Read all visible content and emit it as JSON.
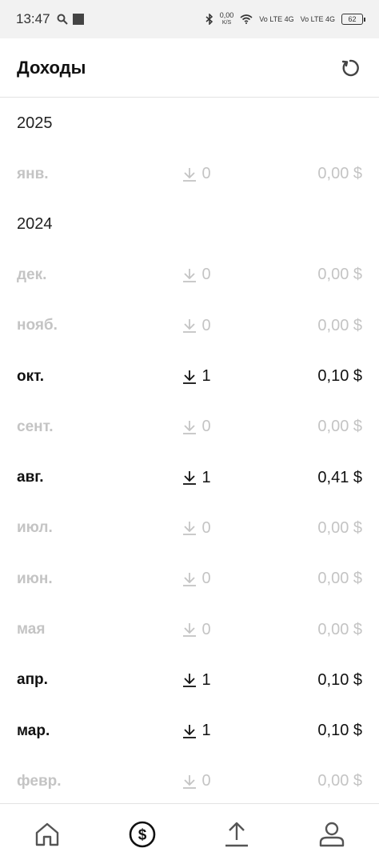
{
  "status_bar": {
    "time": "13:47",
    "net_speed": "0,00",
    "net_unit": "K/S",
    "signal1": "Vo LTE 4G",
    "signal2": "Vo LTE 4G",
    "battery": "62"
  },
  "header": {
    "title": "Доходы",
    "refresh_icon": "refresh-icon"
  },
  "sections": [
    {
      "year": "2025",
      "rows": [
        {
          "month": "янв.",
          "count": "0",
          "amount": "0,00 $",
          "active": false
        }
      ]
    },
    {
      "year": "2024",
      "rows": [
        {
          "month": "дек.",
          "count": "0",
          "amount": "0,00 $",
          "active": false
        },
        {
          "month": "нояб.",
          "count": "0",
          "amount": "0,00 $",
          "active": false
        },
        {
          "month": "окт.",
          "count": "1",
          "amount": "0,10 $",
          "active": true
        },
        {
          "month": "сент.",
          "count": "0",
          "amount": "0,00 $",
          "active": false
        },
        {
          "month": "авг.",
          "count": "1",
          "amount": "0,41 $",
          "active": true
        },
        {
          "month": "июл.",
          "count": "0",
          "amount": "0,00 $",
          "active": false
        },
        {
          "month": "июн.",
          "count": "0",
          "amount": "0,00 $",
          "active": false
        },
        {
          "month": "мая",
          "count": "0",
          "amount": "0,00 $",
          "active": false
        },
        {
          "month": "апр.",
          "count": "1",
          "amount": "0,10 $",
          "active": true
        },
        {
          "month": "мар.",
          "count": "1",
          "amount": "0,10 $",
          "active": true
        },
        {
          "month": "февр.",
          "count": "0",
          "amount": "0,00 $",
          "active": false
        }
      ]
    }
  ],
  "bottom_nav": [
    {
      "name": "home-icon",
      "active": false
    },
    {
      "name": "dollar-circle-icon",
      "active": true
    },
    {
      "name": "upload-icon",
      "active": false
    },
    {
      "name": "profile-icon",
      "active": false
    }
  ]
}
